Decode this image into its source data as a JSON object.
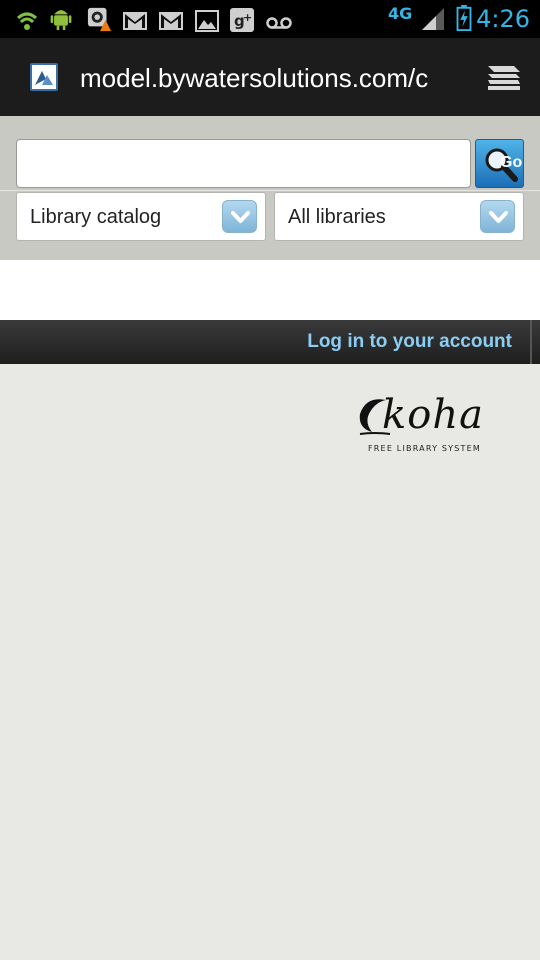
{
  "status_bar": {
    "time": "4:26",
    "network": "4G",
    "icons": [
      "wifi-icon",
      "android-icon",
      "warning-icon",
      "gmail-icon",
      "gmail-icon",
      "gallery-icon",
      "google-plus-icon",
      "voicemail-icon",
      "signal-icon",
      "battery-charging-icon"
    ],
    "accent_color": "#33b5e5"
  },
  "browser": {
    "url": "model.bywatersolutions.com/c",
    "favicon": "koha-favicon-icon",
    "tabs_icon": "tabs-stack-icon"
  },
  "search": {
    "query": "",
    "placeholder": "",
    "go_label": "Go",
    "scope_select": "Library catalog",
    "library_select": "All libraries"
  },
  "nav": {
    "login_label": "Log in to your account",
    "link_color": "#8ccdf3"
  },
  "logo": {
    "wordmark": "koha",
    "tagline": "FREE LIBRARY SYSTEM"
  }
}
